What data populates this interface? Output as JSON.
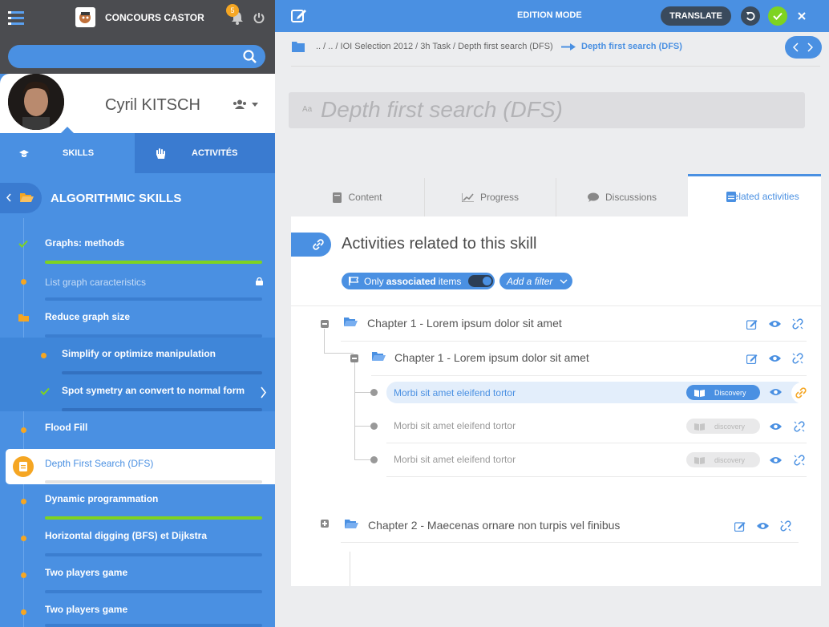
{
  "brand": {
    "name": "CONCOURS CASTOR"
  },
  "notifications": {
    "count": "5"
  },
  "search": {
    "placeholder": ""
  },
  "profile": {
    "name": "Cyril KITSCH"
  },
  "sidebar_tabs": {
    "skills": "SKILLS",
    "activities": "ACTIVITÉS"
  },
  "section": {
    "title": "ALGORITHMIC SKILLS"
  },
  "items": [
    {
      "label": "Graphs: methods",
      "progress": 1.0
    },
    {
      "label": "List graph caracteristics",
      "progress": 0
    },
    {
      "label": "Reduce graph size",
      "progress": 0
    },
    {
      "label": "Simplify or optimize manipulation",
      "progress": 0
    },
    {
      "label": "Spot symetry an convert to normal form",
      "progress": 0
    },
    {
      "label": "Flood Fill",
      "progress": 0
    },
    {
      "label": "Depth First Search (DFS)",
      "progress": 0
    },
    {
      "label": "Dynamic programmation",
      "progress": 1.0
    },
    {
      "label": "Horizontal digging (BFS) et Dijkstra",
      "progress": 0
    },
    {
      "label": "Two players game",
      "progress": 0
    },
    {
      "label": "Two players game",
      "progress": 0
    }
  ],
  "topbar": {
    "mode": "EDITION MODE",
    "translate": "TRANSLATE"
  },
  "breadcrumb": {
    "path": ".. / .. / IOI Selection 2012 / 3h Task / Depth first search (DFS)",
    "current": "Depth first search (DFS)"
  },
  "title_input": {
    "prefix": "Aa",
    "value": "Depth first search (DFS)"
  },
  "tabs": {
    "content": "Content",
    "progress": "Progress",
    "discussions": "Discussions",
    "related": "Related activities"
  },
  "panel": {
    "heading": "Activities related to this skill"
  },
  "filters": {
    "only_prefix": "Only ",
    "only_bold": "associated",
    "only_suffix": " items",
    "add_filter": "Add a filter"
  },
  "tree": {
    "chapter1": "Chapter 1 - Lorem ipsum dolor sit amet",
    "chapter1_sub": "Chapter 1 - Lorem ipsum dolor sit amet",
    "activities": [
      {
        "label": "Morbi sit amet eleifend tortor",
        "badge": "Discovery"
      },
      {
        "label": "Morbi sit amet eleifend tortor",
        "badge": "discovery"
      },
      {
        "label": "Morbi sit amet eleifend tortor",
        "badge": "discovery"
      }
    ],
    "chapter2": "Chapter 2 - Maecenas ornare non turpis vel finibus"
  },
  "colors": {
    "primary": "#4a90e2",
    "dark": "#4b4c50",
    "accent": "#f5a623",
    "success": "#7ed321"
  }
}
